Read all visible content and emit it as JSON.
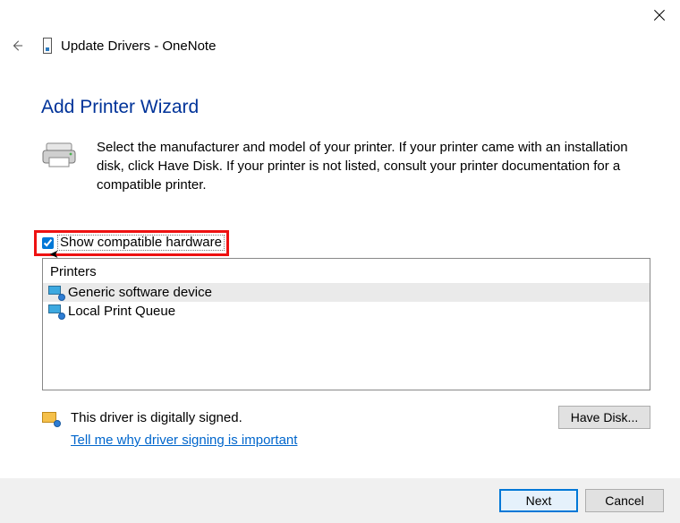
{
  "window": {
    "title_prefix": "Update Drivers",
    "title_subject": "OneNote"
  },
  "wizard": {
    "title": "Add Printer Wizard",
    "description": "Select the manufacturer and model of your printer. If your printer came with an installation disk, click Have Disk. If your printer is not listed, consult your printer documentation for a compatible printer."
  },
  "checkbox": {
    "label": "Show compatible hardware",
    "checked": true
  },
  "list": {
    "header": "Printers",
    "items": [
      {
        "label": "Generic software device",
        "selected": true
      },
      {
        "label": "Local Print Queue",
        "selected": false
      }
    ]
  },
  "signing": {
    "status": "This driver is digitally signed.",
    "link": "Tell me why driver signing is important"
  },
  "buttons": {
    "have_disk": "Have Disk...",
    "next": "Next",
    "cancel": "Cancel"
  },
  "icons": {
    "back": "back-arrow-icon",
    "close": "close-icon",
    "device": "device-icon",
    "printer": "printer-icon",
    "list_item": "printer-list-icon",
    "signed": "cert-icon"
  },
  "highlight": {
    "target": "show-compatible-hardware"
  }
}
